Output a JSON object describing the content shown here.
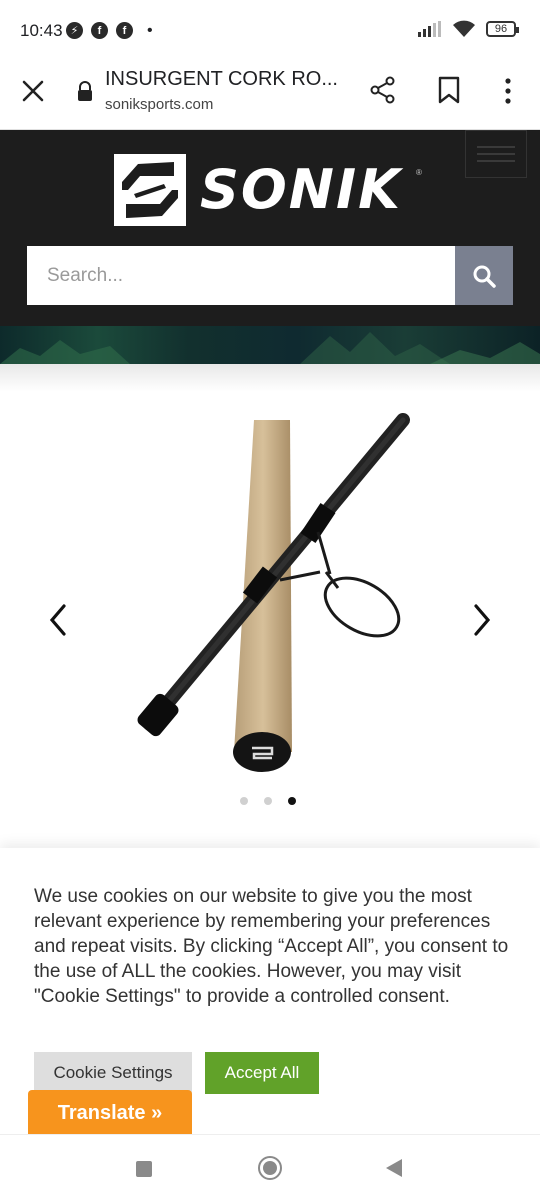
{
  "status_bar": {
    "time": "10:43",
    "battery": "96",
    "app_icons": [
      "messenger-icon",
      "facebook-icon",
      "facebook-icon"
    ],
    "dot": "•"
  },
  "browser": {
    "title": "INSURGENT CORK RO...",
    "url": "soniksports.com"
  },
  "header": {
    "logo_text": "SONIK",
    "logo_reg": "®",
    "search_placeholder": "Search..."
  },
  "carousel": {
    "slide_count": 3,
    "active_index": 2
  },
  "cookie": {
    "message": "We use cookies on our website to give you the most relevant experience by remembering your preferences and repeat visits. By clicking “Accept All”, you consent to the use of ALL the cookies. However, you may visit \"Cookie Settings\" to provide a controlled consent.",
    "settings_label": "Cookie Settings",
    "accept_label": "Accept All"
  },
  "translate": {
    "label": "Translate »"
  },
  "colors": {
    "header_bg": "#1d1d1d",
    "search_button": "#7a8090",
    "accept_green": "#61a229",
    "translate_orange": "#f7941d"
  }
}
